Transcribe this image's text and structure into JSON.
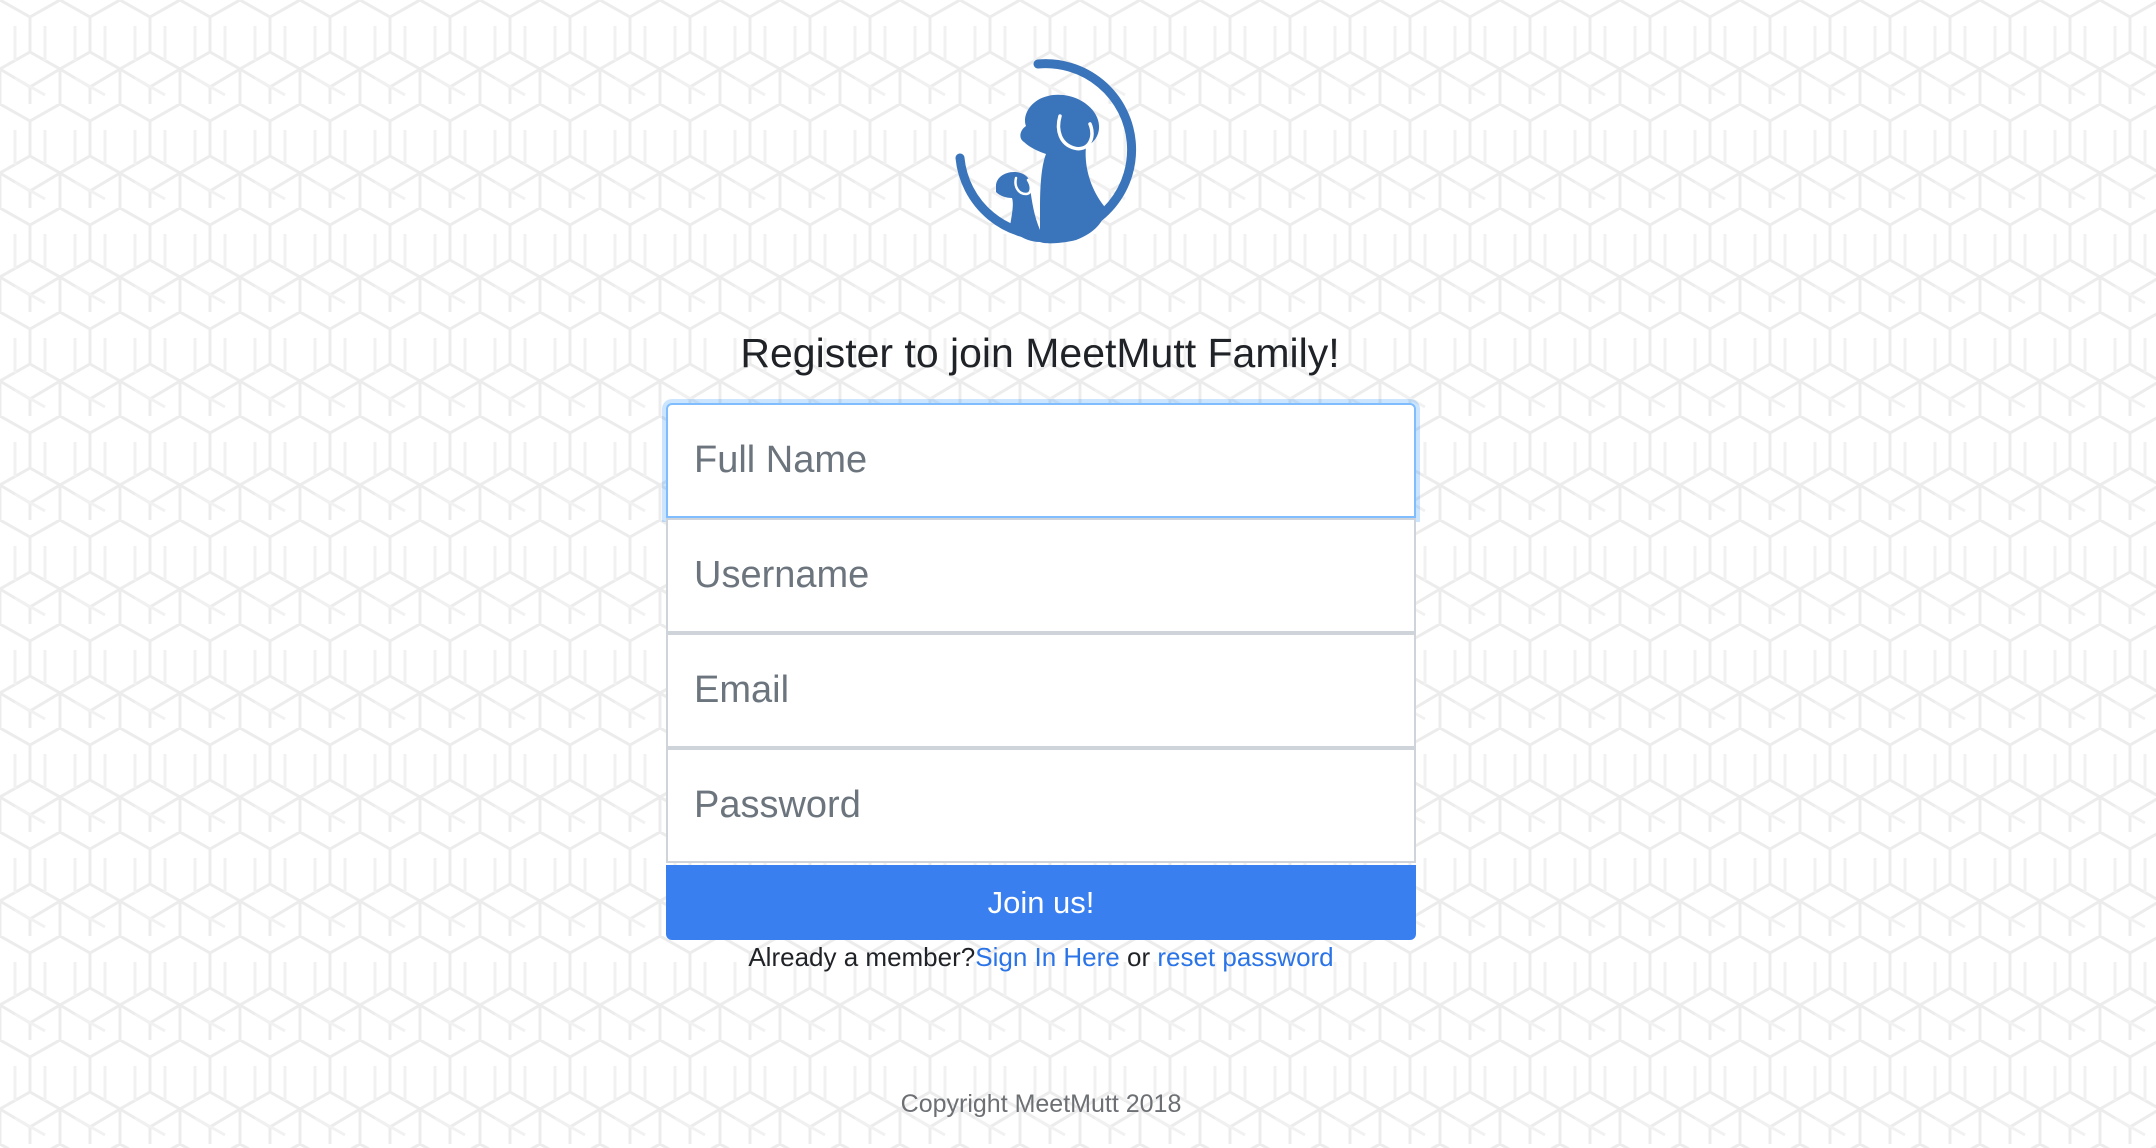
{
  "heading": "Register to join MeetMutt Family!",
  "form": {
    "full_name_placeholder": "Full Name",
    "username_placeholder": "Username",
    "email_placeholder": "Email",
    "password_placeholder": "Password",
    "submit_label": "Join us!"
  },
  "footer_links": {
    "prefix": "Already a member?",
    "sign_in": "Sign In Here",
    "separator": " or ",
    "reset": "reset password"
  },
  "copyright": "Copyright MeetMutt 2018",
  "colors": {
    "brand": "#3a74ba",
    "button": "#3a7ff0",
    "link": "#2a74e8"
  },
  "logo_icon": "dog-and-puppy-logo-icon"
}
